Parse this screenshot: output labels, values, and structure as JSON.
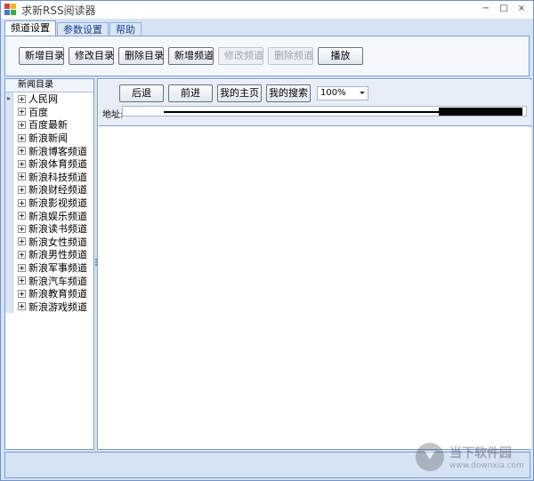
{
  "window": {
    "title": "求新RSS阅读器",
    "controls": {
      "minimize": "−",
      "maximize": "□",
      "close": "×"
    }
  },
  "tabs": [
    {
      "label": "频道设置",
      "active": true
    },
    {
      "label": "参数设置",
      "active": false
    },
    {
      "label": "帮助",
      "active": false
    }
  ],
  "toolbar": {
    "add_dir": "新增目录",
    "edit_dir": "修改目录",
    "delete_dir": "删除目录",
    "add_channel": "新增频道",
    "edit_channel": "修改频道",
    "delete_channel": "删除频道",
    "play": "播放"
  },
  "tree": {
    "header": "新闻目录",
    "items": [
      "人民网",
      "百度",
      "百度最新",
      "新浪新闻",
      "新浪博客频道",
      "新浪体育频道",
      "新浪科技频道",
      "新浪财经频道",
      "新浪影视频道",
      "新浪娱乐频道",
      "新浪读书频道",
      "新浪女性频道",
      "新浪男性频道",
      "新浪军事频道",
      "新浪汽车频道",
      "新浪教育频道",
      "新浪游戏频道"
    ]
  },
  "browser": {
    "back": "后退",
    "forward": "前进",
    "home": "我的主页",
    "search": "我的搜索",
    "zoom": "100%",
    "address_label": "地址:",
    "address_value": ""
  },
  "watermark": {
    "cn": "当下软件园",
    "en": "www.downxia.com"
  },
  "colors": {
    "frame": "#d5e3f5",
    "border": "#7d9fd1",
    "tab_text": "#1a3f8f"
  }
}
